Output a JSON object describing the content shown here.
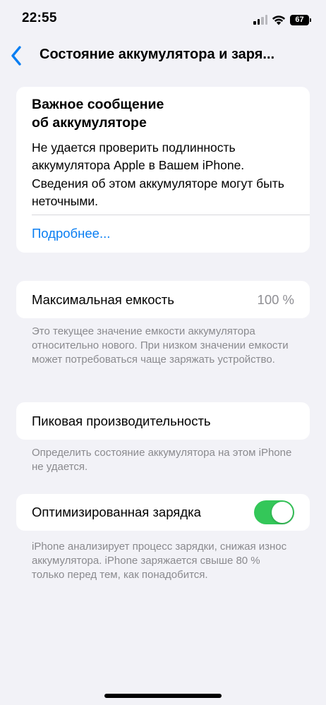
{
  "status_bar": {
    "time": "22:55",
    "battery_level": "67",
    "signal_bars_filled": 2,
    "signal_bars_total": 4,
    "icons": [
      "cellular-signal-icon",
      "wifi-icon",
      "battery-icon"
    ]
  },
  "nav": {
    "back_icon": "chevron-left-icon",
    "title": "Состояние аккумулятора и заря..."
  },
  "battery_message": {
    "title_line1": "Важное сообщение",
    "title_line2": "об аккумуляторе",
    "body": "Не удается проверить подлинность аккумулятора Apple в Вашем iPhone. Сведения об этом аккумуляторе могут быть неточными.",
    "more_link": "Подробнее..."
  },
  "maximum_capacity": {
    "label": "Максимальная емкость",
    "value": "100 %",
    "note": "Это текущее значение емкости аккумулятора относительно нового. При низком значении емкости может потребоваться чаще заряжать устройство."
  },
  "peak_performance": {
    "label": "Пиковая производительность",
    "note": "Определить состояние аккумулятора на этом iPhone не удается."
  },
  "optimized_charging": {
    "label": "Оптимизированная зарядка",
    "enabled": true,
    "note": "iPhone анализирует процесс зарядки, снижая износ аккумулятора. iPhone заряжается свыше 80 % только перед тем, как понадобится."
  },
  "colors": {
    "background": "#f2f2f7",
    "link_blue": "#0a7ef2",
    "toggle_green": "#34c759",
    "secondary_text": "#8a8a8e"
  }
}
